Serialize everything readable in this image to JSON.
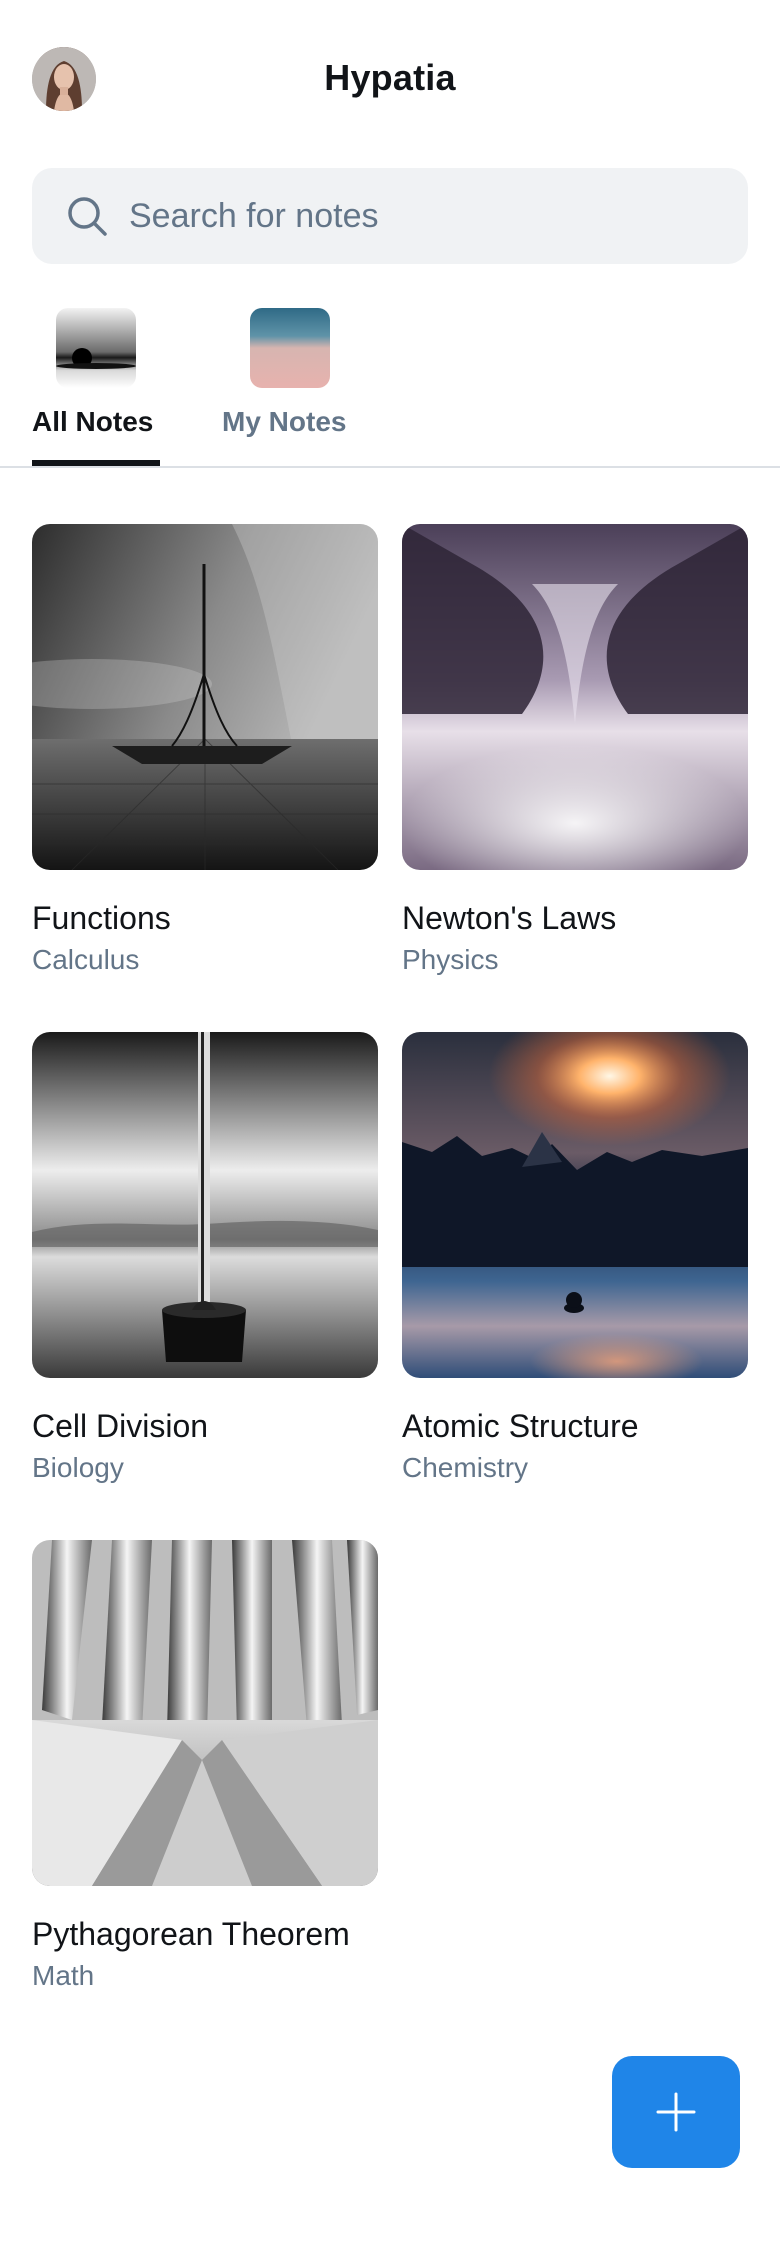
{
  "header": {
    "title": "Hypatia",
    "avatar_icon": "user-avatar"
  },
  "search": {
    "placeholder": "Search for notes",
    "icon": "search-icon"
  },
  "tabs": [
    {
      "label": "All Notes",
      "active": true
    },
    {
      "label": "My Notes",
      "active": false
    }
  ],
  "notes": [
    {
      "title": "Functions",
      "subject": "Calculus"
    },
    {
      "title": "Newton's Laws",
      "subject": "Physics"
    },
    {
      "title": "Cell Division",
      "subject": "Biology"
    },
    {
      "title": "Atomic Structure",
      "subject": "Chemistry"
    },
    {
      "title": "Pythagorean Theorem",
      "subject": "Math"
    }
  ],
  "fab": {
    "icon": "plus-icon"
  },
  "colors": {
    "accent": "#1f85e8",
    "text_primary": "#111418",
    "text_secondary": "#637588",
    "search_bg": "#f0f2f4"
  }
}
